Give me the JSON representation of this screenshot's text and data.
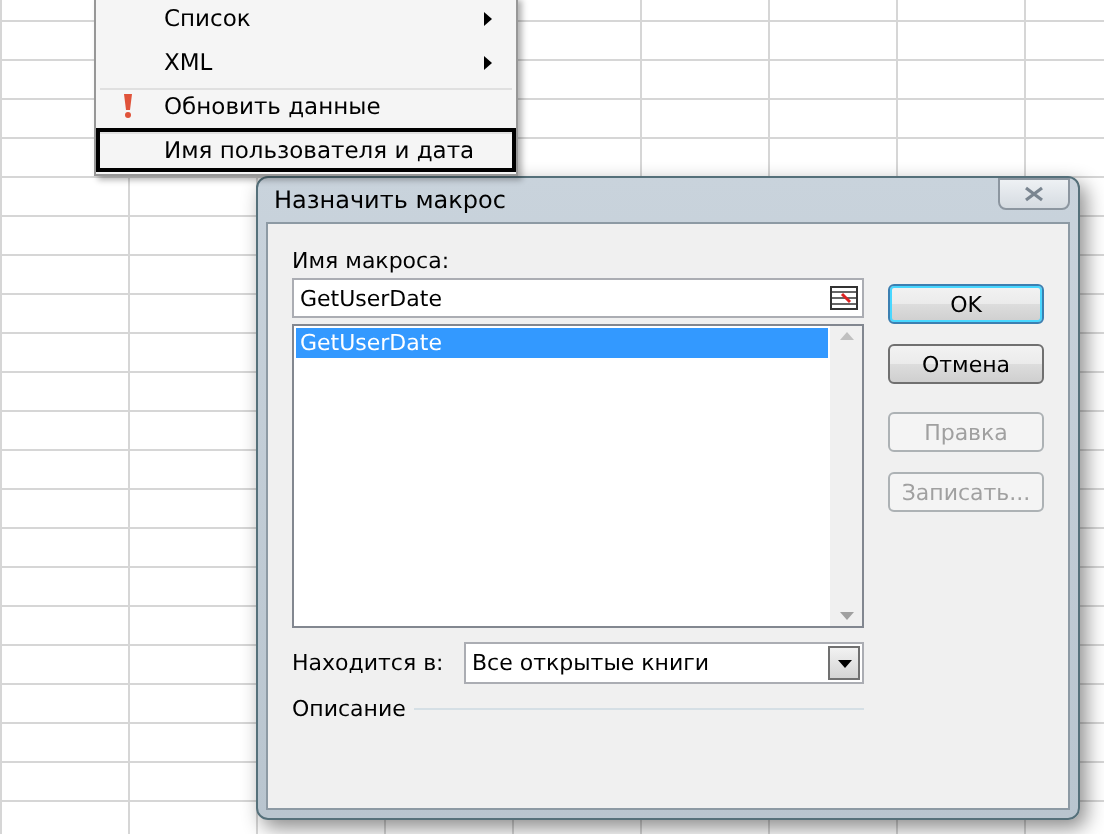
{
  "context_menu": {
    "items": [
      {
        "label": "Список",
        "kind": "submenu",
        "selected": false
      },
      {
        "label": "XML",
        "kind": "submenu",
        "selected": false
      },
      {
        "label": "Обновить данные",
        "kind": "refresh",
        "selected": false
      },
      {
        "label": "Имя пользователя и дата",
        "kind": "plain",
        "selected": true
      }
    ]
  },
  "dialog": {
    "title": "Назначить макрос",
    "macro_name_label": "Имя макроса:",
    "macro_name_value": "GetUserDate",
    "macros": [
      {
        "label": "GetUserDate",
        "selected": true
      }
    ],
    "buttons": [
      {
        "label": "OK",
        "disabled": false,
        "default": true
      },
      {
        "label": "Отмена",
        "disabled": false,
        "default": false
      },
      {
        "label": "Правка",
        "disabled": true,
        "default": false
      },
      {
        "label": "Записать...",
        "disabled": true,
        "default": false
      }
    ],
    "location_label": "Находится в:",
    "location_value": "Все открытые книги",
    "description_label": "Описание"
  }
}
